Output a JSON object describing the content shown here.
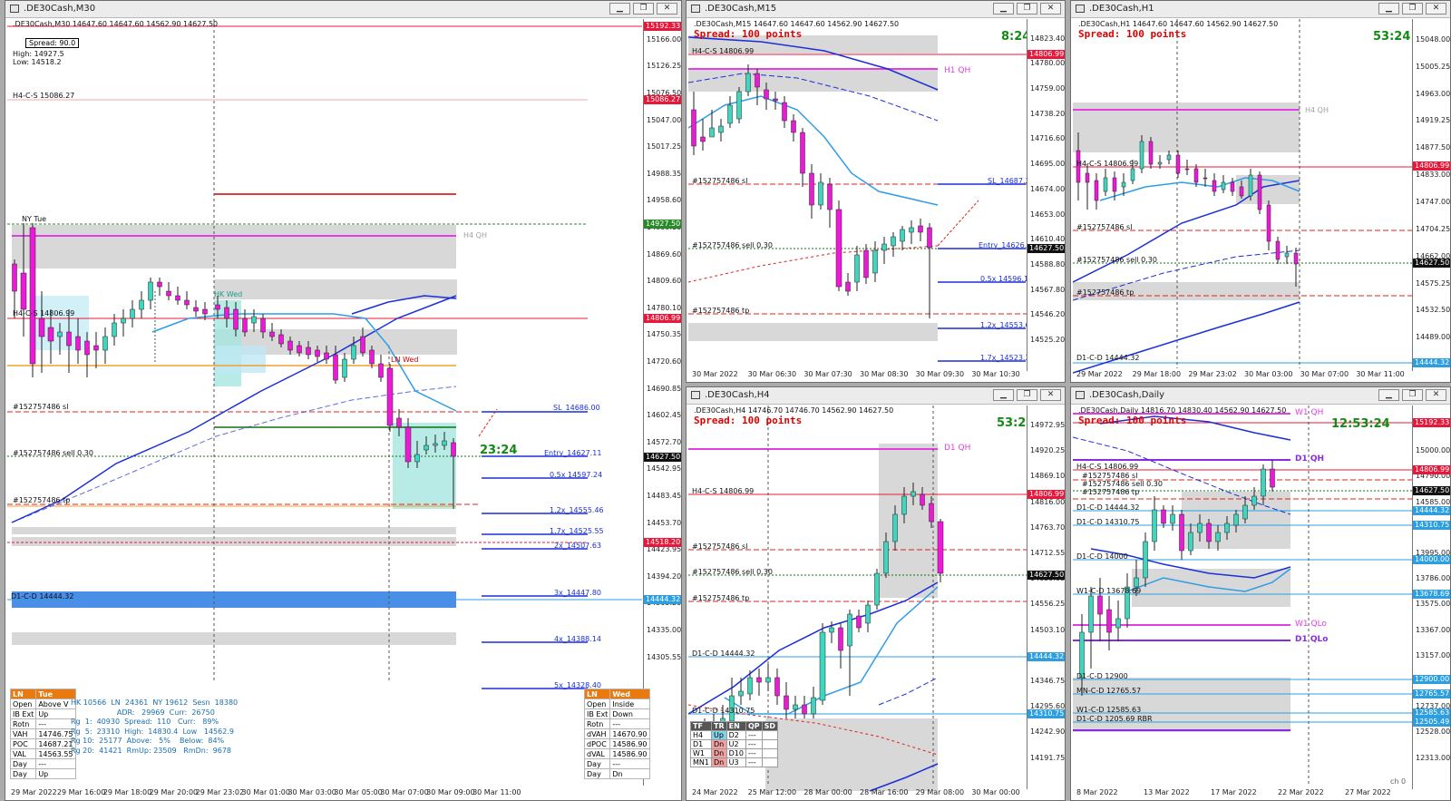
{
  "windows": [
    {
      "id": "m30",
      "title": ".DE30Cash,M30",
      "ohlc_line": ".DE30Cash,M30  14647.60 14647.60 14562.90 14627.50",
      "spread_box": "Spread: 90.0",
      "high": "High: 14927.5",
      "low": "Low: 14518.2",
      "timer": "23:24",
      "price_axis": [
        "15166.00",
        "15126.25",
        "15076.50",
        "15047.00",
        "15017.25",
        "14988.35",
        "14958.60",
        "14899.10",
        "14869.60",
        "14809.60",
        "14780.10",
        "14750.35",
        "14720.60",
        "14690.85",
        "14602.45",
        "14572.70",
        "14542.95",
        "14483.45",
        "14453.70",
        "14423.95",
        "14394.20",
        "14365.20",
        "14335.00",
        "14305.55"
      ],
      "price_boxes": [
        {
          "value": "15192.33",
          "color": "#e8183a"
        },
        {
          "value": "15086.27",
          "color": "#e8183a"
        },
        {
          "value": "14927.50",
          "color": "#2a8a2a"
        },
        {
          "value": "14806.99",
          "color": "#e8183a"
        },
        {
          "value": "14627.50",
          "color": "#111111"
        },
        {
          "value": "14518.20",
          "color": "#e8183a"
        },
        {
          "value": "14444.32",
          "color": "#2d9fe0"
        }
      ],
      "line_labels": [
        "H4-C-S 15086.27",
        "NY Tue",
        "H4 QH",
        "H4-C-S 14806.99",
        "LN Wed",
        "HK Wed",
        "#152757486 sl",
        "#152757486 sell 0.30",
        "#152757486 tp",
        "D1-C-D 14444.32"
      ],
      "fib_labels": [
        "SL_14686.00",
        "Entry_14627.11",
        "0.5x 14597.24",
        "1.2x_14555.46",
        "1.7x_14525.55",
        "2x_14507.63",
        "3x_14447.80",
        "4x_14388.14",
        "5x_14328.40"
      ],
      "dates": [
        "29 Mar 2022",
        "29 Mar 16:00",
        "29 Mar 18:00",
        "29 Mar 20:00",
        "29 Mar 23:02",
        "30 Mar 01:00",
        "30 Mar 03:00",
        "30 Mar 05:00",
        "30 Mar 07:00",
        "30 Mar 09:00",
        "30 Mar 11:00"
      ],
      "left_table": {
        "head": [
          "LN",
          "Tue"
        ],
        "rows": [
          [
            "Open",
            "Above V"
          ],
          [
            "IB Ext",
            "Up"
          ],
          [
            "Rotn",
            "---"
          ],
          [
            "VAH",
            "14746.75"
          ],
          [
            "POC",
            "14687.21"
          ],
          [
            "VAL",
            "14563.55"
          ],
          [
            "Day",
            "---"
          ],
          [
            "Day",
            "Up"
          ]
        ]
      },
      "stats_text": "HK 10566  LN  24361  NY 19612  Sesn  18380\n                    ADR:   29969  Curr:  26750\nRg  1:  40930  Spread:  110   Curr:   89%\nRg  5:  23310  High:  14830.4  Low   14562.9\nRg 10:  25177  Above:   5%    Below:  84%\nRg 20:  41421  RmUp: 23509   RmDn:  9678",
      "right_table": {
        "head": [
          "LN",
          "Wed"
        ],
        "rows": [
          [
            "Open",
            "Inside"
          ],
          [
            "IB Ext",
            "Down"
          ],
          [
            "Rotn",
            "---"
          ],
          [
            "dVAH",
            "14670.90"
          ],
          [
            "dPOC",
            "14586.90"
          ],
          [
            "dVAL",
            "14586.90"
          ],
          [
            "Day",
            "---"
          ],
          [
            "Day",
            "Dn"
          ]
        ]
      }
    },
    {
      "id": "m15",
      "title": ".DE30Cash,M15",
      "ohlc_line": ".DE30Cash,M15  14647.60 14647.60 14562.90 14627.50",
      "spread": "Spread: 100 points",
      "timer": "8:24",
      "price_axis": [
        "14823.40",
        "14780.00",
        "14759.00",
        "14738.20",
        "14716.60",
        "14695.00",
        "14674.00",
        "14653.00",
        "14610.40",
        "14588.80",
        "14567.80",
        "14546.20",
        "14525.20"
      ],
      "price_boxes": [
        {
          "value": "14806.99",
          "color": "#e8183a"
        },
        {
          "value": "14627.50",
          "color": "#111111"
        }
      ],
      "line_labels": [
        "H4-C-S 14806.99",
        "H1 QH",
        "#152757486 sl",
        "#152757486 sell 0.30",
        "#152757486 tp"
      ],
      "fib_labels": [
        "SL_14687.23",
        "Entry_14626.51",
        "0.5x 14596.15",
        "1.2x_14553.64",
        "1.7x_14523.28"
      ],
      "dates": [
        "30 Mar 2022",
        "30 Mar 06:30",
        "30 Mar 07:30",
        "30 Mar 08:30",
        "30 Mar 09:30",
        "30 Mar 10:30"
      ]
    },
    {
      "id": "h1",
      "title": ".DE30Cash,H1",
      "ohlc_line": ".DE30Cash,H1  14647.60 14647.60 14562.90 14627.50",
      "spread": "Spread: 100 points",
      "timer": "53:24",
      "price_axis": [
        "15048.00",
        "15005.25",
        "14963.00",
        "14919.25",
        "14877.50",
        "14833.00",
        "14747.00",
        "14704.25",
        "14662.00",
        "14575.25",
        "14532.50",
        "14489.00"
      ],
      "price_boxes": [
        {
          "value": "14806.99",
          "color": "#e8183a"
        },
        {
          "value": "14627.50",
          "color": "#111111"
        },
        {
          "value": "14444.32",
          "color": "#2d9fe0"
        }
      ],
      "line_labels": [
        "H4 QH",
        "H4-C-S 14806.99",
        "#152757486 sl",
        "#152757486 sell 0.30",
        "#152757486 tp",
        "D1-C-D 14444.32"
      ],
      "dates": [
        "29 Mar 2022",
        "29 Mar 18:00",
        "29 Mar 23:02",
        "30 Mar 03:00",
        "30 Mar 07:00",
        "30 Mar 11:00"
      ]
    },
    {
      "id": "h4",
      "title": ".DE30Cash,H4",
      "ohlc_line": ".DE30Cash,H4  14746.70 14746.70 14562.90 14627.50",
      "spread": "Spread: 100 points",
      "timer": "53:24",
      "price_axis": [
        "14972.95",
        "14920.25",
        "14869.10",
        "14816.00",
        "14763.70",
        "14712.55",
        "14659.85",
        "14556.25",
        "14503.10",
        "14399.45",
        "14346.75",
        "14295.60",
        "14242.90",
        "14191.75"
      ],
      "price_boxes": [
        {
          "value": "14806.99",
          "color": "#e8183a"
        },
        {
          "value": "14627.50",
          "color": "#111111"
        },
        {
          "value": "14444.32",
          "color": "#2d9fe0"
        },
        {
          "value": "14310.75",
          "color": "#2d9fe0"
        }
      ],
      "line_labels": [
        "D1 QH",
        "H4-C-S 14806.99",
        "#152757486 sl",
        "#152757486 sell 0.30",
        "#152757486 tp",
        "D1-C-D 14444.32",
        "D1-C-D 14310.75"
      ],
      "tf_table": [
        [
          "TF",
          "TR",
          "EN",
          "QP",
          "SD"
        ],
        [
          "H4",
          "Up",
          "D2",
          "---",
          ""
        ],
        [
          "D1",
          "Dn",
          "U2",
          "---",
          ""
        ],
        [
          "W1",
          "Dn",
          "D10",
          "---",
          ""
        ],
        [
          "MN1",
          "Dn",
          "U3",
          "---",
          ""
        ]
      ],
      "dates": [
        "24 Mar 2022",
        "25 Mar 12:00",
        "28 Mar 00:00",
        "28 Mar 16:00",
        "29 Mar 08:00",
        "30 Mar 00:00"
      ]
    },
    {
      "id": "d1",
      "title": ".DE30Cash,Daily",
      "ohlc_line": ".DE30Cash,Daily  14816.70 14830.40 14562.90 14627.50",
      "spread": "Spread: 100 points",
      "timer": "12:53:24",
      "price_axis": [
        "15253.90",
        "15000.00",
        "14790.00",
        "14585.00",
        "14205.00",
        "13995.00",
        "13786.00",
        "13575.00",
        "13367.00",
        "13157.00",
        "12948.00",
        "12737.00",
        "12528.00",
        "12313.00"
      ],
      "price_boxes": [
        {
          "value": "15192.33",
          "color": "#e8183a"
        },
        {
          "value": "14806.99",
          "color": "#e8183a"
        },
        {
          "value": "14627.50",
          "color": "#111111"
        },
        {
          "value": "14444.32",
          "color": "#2d9fe0"
        },
        {
          "value": "14310.75",
          "color": "#2d9fe0"
        },
        {
          "value": "14000.00",
          "color": "#2d9fe0"
        },
        {
          "value": "13678.69",
          "color": "#2d9fe0"
        },
        {
          "value": "12900.00",
          "color": "#2d9fe0"
        },
        {
          "value": "12765.57",
          "color": "#2d9fe0"
        },
        {
          "value": "12585.63",
          "color": "#2d9fe0"
        },
        {
          "value": "12505.49",
          "color": "#2d9fe0"
        }
      ],
      "line_labels": [
        "W1 QH",
        "D1 QH",
        "H4-C-S 14806.99",
        "#152757486 sl",
        "#152757486 sell 0.30",
        "#152757486 tp",
        "D1-C-D 14444.32",
        "D1-C-D 14310.75",
        "D1-C-D 14000",
        "W1-C-D 13678.69",
        "W1 QLo",
        "D1 QLo",
        "D1-C-D 12900",
        "MN-C-D 12765.57",
        "W1-C-D 12585.63",
        "D1-C-D 1205.69 RBR"
      ],
      "dates": [
        "8 Mar 2022",
        "13 Mar 2022",
        "17 Mar 2022",
        "22 Mar 2022",
        "27 Mar 2022"
      ],
      "corner": "ch 0"
    }
  ],
  "window_buttons": [
    "minimize",
    "maximize",
    "close"
  ],
  "colors": {
    "bull": "#3fd6c0",
    "bear": "#ee19d8",
    "ma_blue": "#1b2fd8",
    "ma_light": "#2f9de6",
    "zone": "#d6d6d6",
    "sl": "#e02020",
    "tp": "#e02020",
    "magenta": "#e040e0"
  }
}
